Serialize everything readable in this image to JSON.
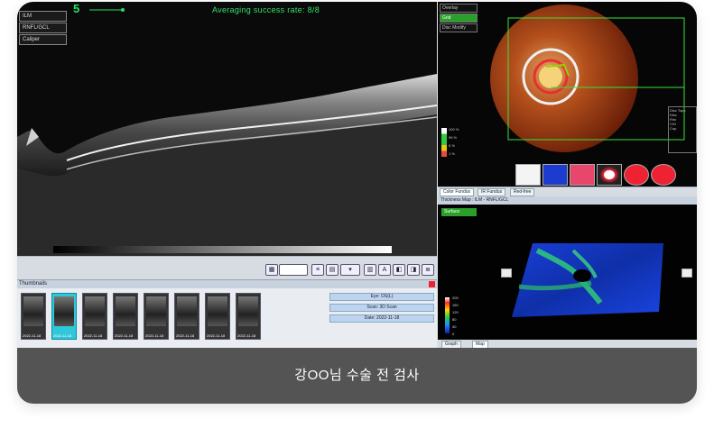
{
  "oct": {
    "frame_number": "5",
    "success_rate_text": "Averaging success rate: 8/8",
    "layers": [
      "ILM",
      "RNFL/GCL",
      "Caliper"
    ]
  },
  "thumbnails": {
    "title": "Thumbnails",
    "dates": [
      "2022-11-18",
      "2022-11-18",
      "2022-11-18",
      "2022-11-18",
      "2022-11-18",
      "2022-11-18",
      "2022-11-18",
      "2022-11-18"
    ],
    "selected_index": 1,
    "info": [
      "Eye: OS(L)",
      "Scan: 3D Scan",
      "Date: 2022-11-18"
    ]
  },
  "fundus": {
    "overlay_items": [
      "Overlay",
      "Grid",
      "Disc Modify"
    ],
    "scale_labels": [
      "100 %",
      "95 %",
      "5 %",
      "1 %"
    ],
    "side_box_lines": [
      "Disc Topo",
      "Disc",
      "Rim",
      "C/D",
      "Cup"
    ],
    "tabs": [
      "Color Fundus",
      "IR Fundus",
      "Red-free"
    ]
  },
  "thickness_map": {
    "header": "Thickness Map : ILM - RNFL/GCL",
    "surface_label": "Surface",
    "colorbar_labels": [
      "200",
      "160",
      "120",
      "80",
      "40",
      "0"
    ],
    "bottom_tabs": [
      "Graph",
      "Map"
    ]
  },
  "caption": "강OO님 수술 전 검사"
}
